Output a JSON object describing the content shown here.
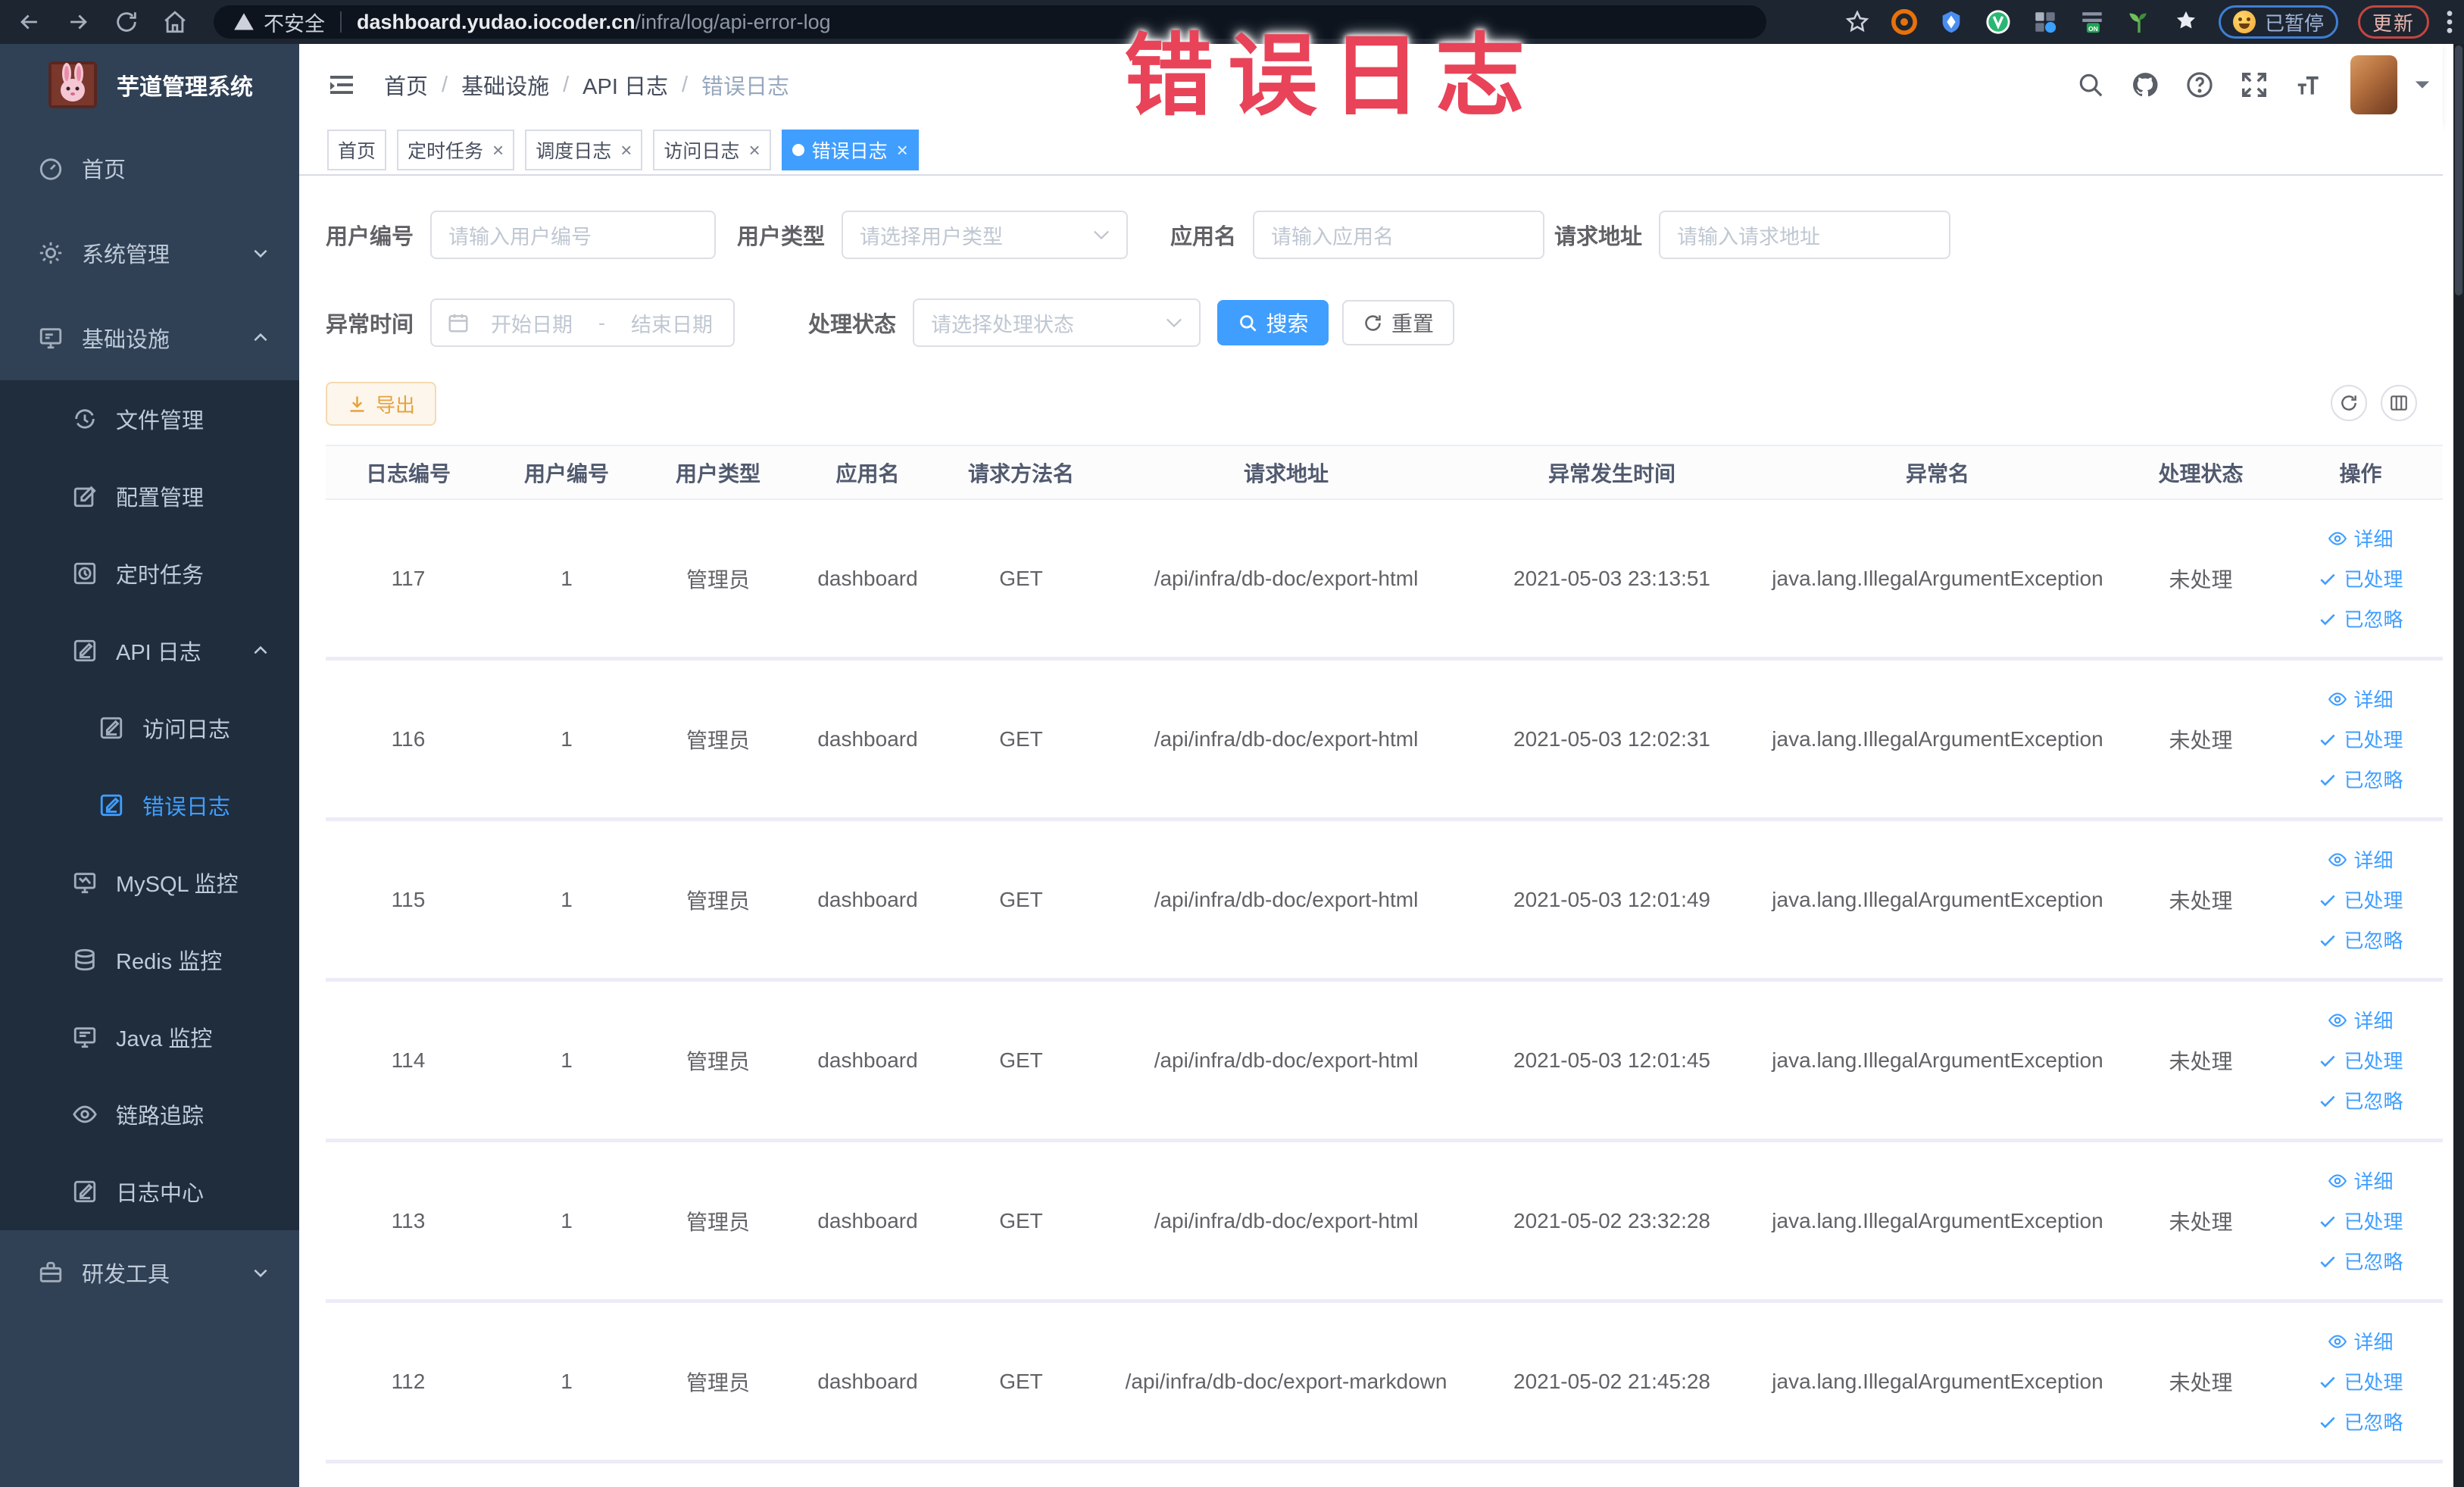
{
  "browser": {
    "security_label": "不安全",
    "url_domain": "dashboard.yudao.iocoder.cn",
    "url_path": "/infra/log/api-error-log",
    "paused_label": "已暂停",
    "update_label": "更新"
  },
  "watermark": "错误日志",
  "sidebar": {
    "title": "芋道管理系统",
    "items": [
      {
        "label": "首页"
      },
      {
        "label": "系统管理"
      },
      {
        "label": "基础设施"
      },
      {
        "label": "文件管理"
      },
      {
        "label": "配置管理"
      },
      {
        "label": "定时任务"
      },
      {
        "label": "API 日志"
      },
      {
        "label": "访问日志"
      },
      {
        "label": "错误日志"
      },
      {
        "label": "MySQL 监控"
      },
      {
        "label": "Redis 监控"
      },
      {
        "label": "Java 监控"
      },
      {
        "label": "链路追踪"
      },
      {
        "label": "日志中心"
      },
      {
        "label": "研发工具"
      }
    ]
  },
  "header": {
    "breadcrumb": [
      "首页",
      "基础设施",
      "API 日志",
      "错误日志"
    ]
  },
  "tabs": [
    {
      "label": "首页"
    },
    {
      "label": "定时任务"
    },
    {
      "label": "调度日志"
    },
    {
      "label": "访问日志"
    },
    {
      "label": "错误日志"
    }
  ],
  "filters": {
    "user_id": {
      "label": "用户编号",
      "placeholder": "请输入用户编号"
    },
    "user_type": {
      "label": "用户类型",
      "placeholder": "请选择用户类型"
    },
    "app_name": {
      "label": "应用名",
      "placeholder": "请输入应用名"
    },
    "request_url": {
      "label": "请求地址",
      "placeholder": "请输入请求地址"
    },
    "exception_time": {
      "label": "异常时间",
      "start_placeholder": "开始日期",
      "separator": "-",
      "end_placeholder": "结束日期"
    },
    "process_status": {
      "label": "处理状态",
      "placeholder": "请选择处理状态"
    },
    "search_label": "搜索",
    "reset_label": "重置"
  },
  "toolbar": {
    "export_label": "导出"
  },
  "table": {
    "columns": [
      "日志编号",
      "用户编号",
      "用户类型",
      "应用名",
      "请求方法名",
      "请求地址",
      "异常发生时间",
      "异常名",
      "处理状态",
      "操作"
    ],
    "ops": {
      "detail": "详细",
      "processed": "已处理",
      "ignored": "已忽略"
    },
    "rows": [
      {
        "id": "117",
        "user_id": "1",
        "user_type": "管理员",
        "app": "dashboard",
        "method": "GET",
        "url": "/api/infra/db-doc/export-html",
        "time": "2021-05-03 23:13:51",
        "exception": "java.lang.IllegalArgumentException",
        "status": "未处理"
      },
      {
        "id": "116",
        "user_id": "1",
        "user_type": "管理员",
        "app": "dashboard",
        "method": "GET",
        "url": "/api/infra/db-doc/export-html",
        "time": "2021-05-03 12:02:31",
        "exception": "java.lang.IllegalArgumentException",
        "status": "未处理"
      },
      {
        "id": "115",
        "user_id": "1",
        "user_type": "管理员",
        "app": "dashboard",
        "method": "GET",
        "url": "/api/infra/db-doc/export-html",
        "time": "2021-05-03 12:01:49",
        "exception": "java.lang.IllegalArgumentException",
        "status": "未处理"
      },
      {
        "id": "114",
        "user_id": "1",
        "user_type": "管理员",
        "app": "dashboard",
        "method": "GET",
        "url": "/api/infra/db-doc/export-html",
        "time": "2021-05-03 12:01:45",
        "exception": "java.lang.IllegalArgumentException",
        "status": "未处理"
      },
      {
        "id": "113",
        "user_id": "1",
        "user_type": "管理员",
        "app": "dashboard",
        "method": "GET",
        "url": "/api/infra/db-doc/export-html",
        "time": "2021-05-02 23:32:28",
        "exception": "java.lang.IllegalArgumentException",
        "status": "未处理"
      },
      {
        "id": "112",
        "user_id": "1",
        "user_type": "管理员",
        "app": "dashboard",
        "method": "GET",
        "url": "/api/infra/db-doc/export-markdown",
        "time": "2021-05-02 21:45:28",
        "exception": "java.lang.IllegalArgumentException",
        "status": "未处理"
      }
    ]
  },
  "colors": {
    "accent": "#409eff",
    "sidebar_bg": "#304156",
    "submenu_bg": "#1f2d3d",
    "watermark_red": "#e84358",
    "warning": "#e6a23c"
  }
}
